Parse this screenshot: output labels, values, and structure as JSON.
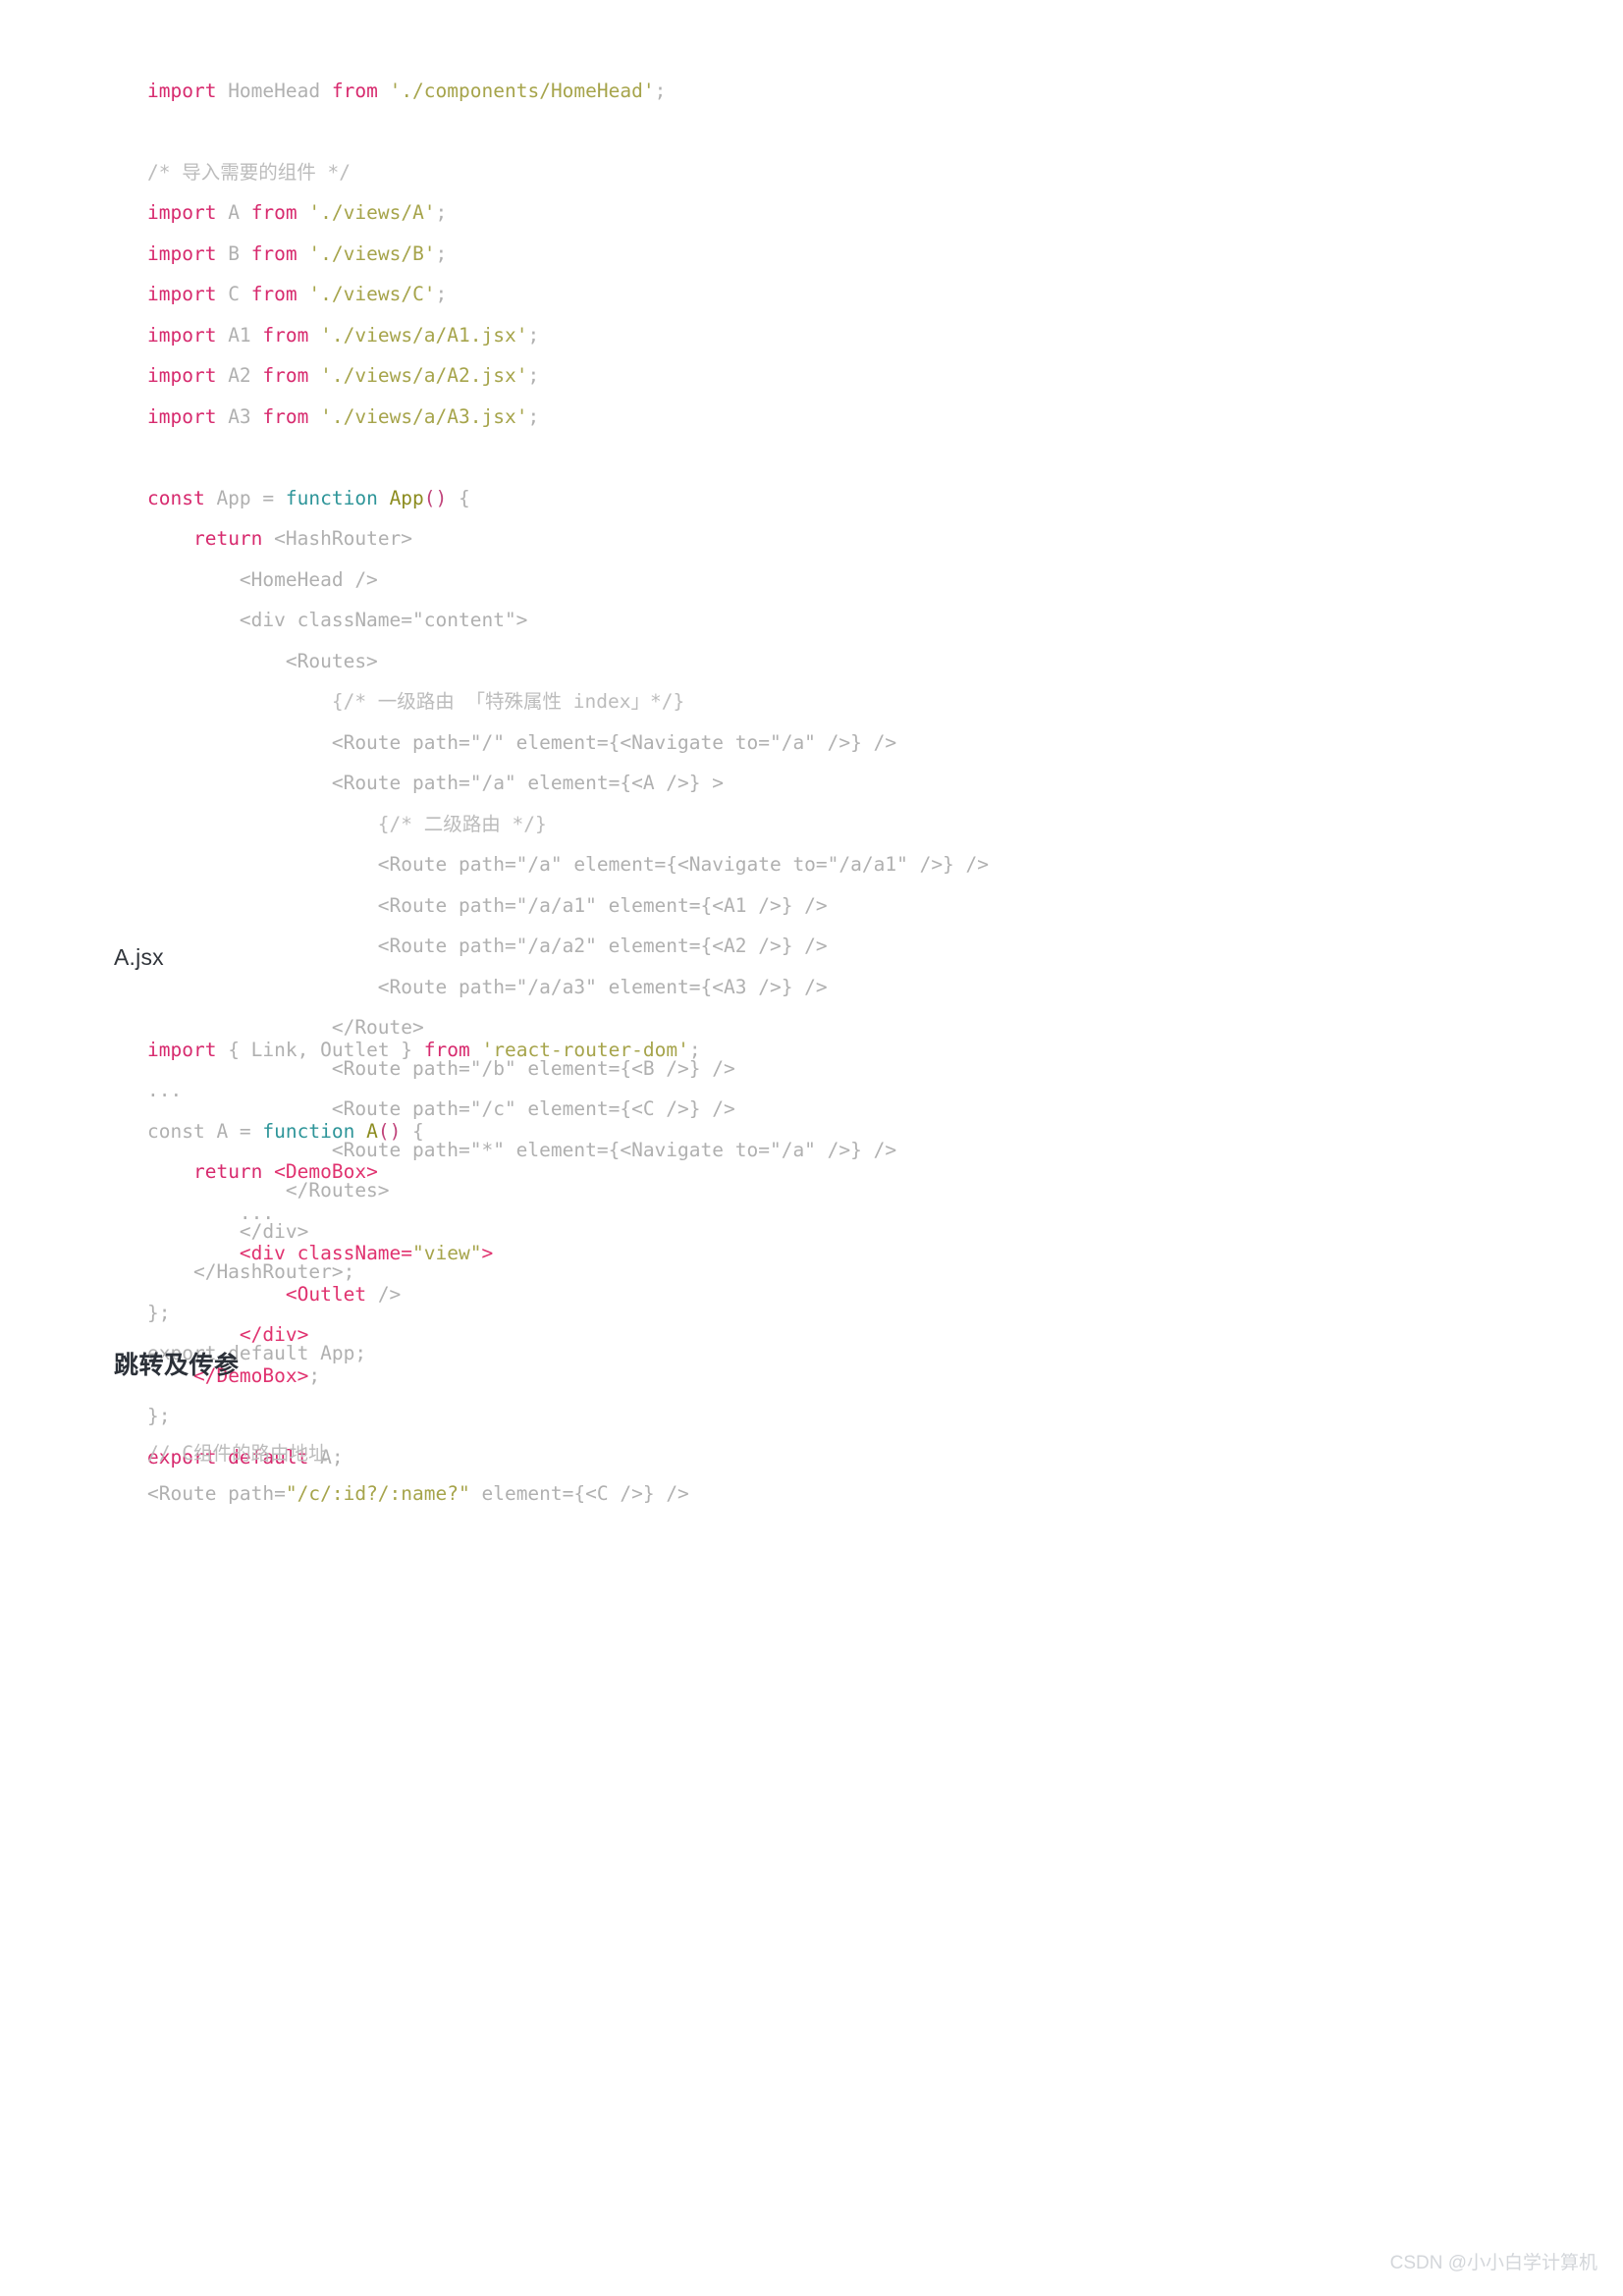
{
  "document": {
    "type": "blog-article-code-listing",
    "watermark": "CSDN @小小白学计算机",
    "background_color": "#ffffff",
    "colors": {
      "keyword": "#d72a6e",
      "string": "#a6a44b",
      "function_keyword": "#2e9599",
      "function_name": "#8c8c1f",
      "plain": "#b3b3b3",
      "comment": "#bcbcbc",
      "heading": "#2b3038"
    }
  },
  "headings": {
    "file_heading": "A.jsx",
    "section_heading": "跳转及传参"
  },
  "code_blocks": [
    {
      "id": "app-jsx",
      "lines": [
        [
          {
            "t": "import",
            "c": "kw"
          },
          {
            "t": " HomeHead ",
            "c": "plain"
          },
          {
            "t": "from",
            "c": "kw"
          },
          {
            "t": " ",
            "c": "plain"
          },
          {
            "t": "'./components/HomeHead'",
            "c": "str"
          },
          {
            "t": ";",
            "c": "plain"
          }
        ],
        [],
        [
          {
            "t": "/* 导入需要的组件 */",
            "c": "cmt"
          }
        ],
        [
          {
            "t": "import",
            "c": "kw"
          },
          {
            "t": " A ",
            "c": "plain"
          },
          {
            "t": "from",
            "c": "kw"
          },
          {
            "t": " ",
            "c": "plain"
          },
          {
            "t": "'./views/A'",
            "c": "str"
          },
          {
            "t": ";",
            "c": "plain"
          }
        ],
        [
          {
            "t": "import",
            "c": "kw"
          },
          {
            "t": " B ",
            "c": "plain"
          },
          {
            "t": "from",
            "c": "kw"
          },
          {
            "t": " ",
            "c": "plain"
          },
          {
            "t": "'./views/B'",
            "c": "str"
          },
          {
            "t": ";",
            "c": "plain"
          }
        ],
        [
          {
            "t": "import",
            "c": "kw"
          },
          {
            "t": " C ",
            "c": "plain"
          },
          {
            "t": "from",
            "c": "kw"
          },
          {
            "t": " ",
            "c": "plain"
          },
          {
            "t": "'./views/C'",
            "c": "str"
          },
          {
            "t": ";",
            "c": "plain"
          }
        ],
        [
          {
            "t": "import",
            "c": "kw"
          },
          {
            "t": " A1 ",
            "c": "plain"
          },
          {
            "t": "from",
            "c": "kw"
          },
          {
            "t": " ",
            "c": "plain"
          },
          {
            "t": "'./views/a/A1.jsx'",
            "c": "str"
          },
          {
            "t": ";",
            "c": "plain"
          }
        ],
        [
          {
            "t": "import",
            "c": "kw"
          },
          {
            "t": " A2 ",
            "c": "plain"
          },
          {
            "t": "from",
            "c": "kw"
          },
          {
            "t": " ",
            "c": "plain"
          },
          {
            "t": "'./views/a/A2.jsx'",
            "c": "str"
          },
          {
            "t": ";",
            "c": "plain"
          }
        ],
        [
          {
            "t": "import",
            "c": "kw"
          },
          {
            "t": " A3 ",
            "c": "plain"
          },
          {
            "t": "from",
            "c": "kw"
          },
          {
            "t": " ",
            "c": "plain"
          },
          {
            "t": "'./views/a/A3.jsx'",
            "c": "str"
          },
          {
            "t": ";",
            "c": "plain"
          }
        ],
        [],
        [
          {
            "t": "const",
            "c": "kw2"
          },
          {
            "t": " App = ",
            "c": "plain"
          },
          {
            "t": "function",
            "c": "fn"
          },
          {
            "t": " ",
            "c": "plain"
          },
          {
            "t": "App",
            "c": "fname"
          },
          {
            "t": "()",
            "c": "punc"
          },
          {
            "t": " {",
            "c": "plain"
          }
        ],
        [
          {
            "t": "    ",
            "c": "plain"
          },
          {
            "t": "return",
            "c": "kw"
          },
          {
            "t": " <HashRouter>",
            "c": "plain"
          }
        ],
        [
          {
            "t": "        <HomeHead />",
            "c": "plain"
          }
        ],
        [
          {
            "t": "        <div className=\"content\">",
            "c": "plain"
          }
        ],
        [
          {
            "t": "            <Routes>",
            "c": "plain"
          }
        ],
        [
          {
            "t": "                {/* 一级路由 「特殊属性 index」*/}",
            "c": "cmt"
          }
        ],
        [
          {
            "t": "                <Route path=\"/\" element={<Navigate to=\"/a\" />} />",
            "c": "plain"
          }
        ],
        [
          {
            "t": "                <Route path=\"/a\" element={<A />} >",
            "c": "plain"
          }
        ],
        [
          {
            "t": "                    {/* 二级路由 */}",
            "c": "cmt"
          }
        ],
        [
          {
            "t": "                    <Route path=\"/a\" element={<Navigate to=\"/a/a1\" />} />",
            "c": "plain"
          }
        ],
        [
          {
            "t": "                    <Route path=\"/a/a1\" element={<A1 />} />",
            "c": "plain"
          }
        ],
        [
          {
            "t": "                    <Route path=\"/a/a2\" element={<A2 />} />",
            "c": "plain"
          }
        ],
        [
          {
            "t": "                    <Route path=\"/a/a3\" element={<A3 />} />",
            "c": "plain"
          }
        ],
        [
          {
            "t": "                </Route>",
            "c": "plain"
          }
        ],
        [
          {
            "t": "                <Route path=\"/b\" element={<B />} />",
            "c": "plain"
          }
        ],
        [
          {
            "t": "                <Route path=\"/c\" element={<C />} />",
            "c": "plain"
          }
        ],
        [
          {
            "t": "                <Route path=\"*\" element={<Navigate to=\"/a\" />} />",
            "c": "plain"
          }
        ],
        [
          {
            "t": "            </Routes>",
            "c": "plain"
          }
        ],
        [
          {
            "t": "        </div>",
            "c": "plain"
          }
        ],
        [
          {
            "t": "    </HashRouter>;",
            "c": "plain"
          }
        ],
        [
          {
            "t": "};",
            "c": "plain"
          }
        ],
        [
          {
            "t": "export default App;",
            "c": "plain"
          }
        ]
      ]
    },
    {
      "id": "a-jsx",
      "lines": [
        [
          {
            "t": "import",
            "c": "kw"
          },
          {
            "t": " { Link, Outlet } ",
            "c": "plain"
          },
          {
            "t": "from",
            "c": "kw"
          },
          {
            "t": " ",
            "c": "plain"
          },
          {
            "t": "'react-router-dom'",
            "c": "str"
          },
          {
            "t": ";",
            "c": "plain"
          }
        ],
        [
          {
            "t": "...",
            "c": "plain"
          }
        ],
        [
          {
            "t": "const",
            "c": "plain"
          },
          {
            "t": " A = ",
            "c": "plain"
          },
          {
            "t": "function",
            "c": "fn"
          },
          {
            "t": " ",
            "c": "plain"
          },
          {
            "t": "A",
            "c": "fname"
          },
          {
            "t": "()",
            "c": "punc"
          },
          {
            "t": " {",
            "c": "plain"
          }
        ],
        [
          {
            "t": "    ",
            "c": "plain"
          },
          {
            "t": "return",
            "c": "kw"
          },
          {
            "t": " ",
            "c": "plain"
          },
          {
            "t": "<DemoBox>",
            "c": "tag"
          }
        ],
        [
          {
            "t": "        ...",
            "c": "plain"
          }
        ],
        [
          {
            "t": "        ",
            "c": "plain"
          },
          {
            "t": "<div ",
            "c": "tag"
          },
          {
            "t": "className=",
            "c": "attr"
          },
          {
            "t": "\"view\"",
            "c": "str"
          },
          {
            "t": ">",
            "c": "tag"
          }
        ],
        [
          {
            "t": "            ",
            "c": "plain"
          },
          {
            "t": "<Outlet",
            "c": "tag"
          },
          {
            "t": " />",
            "c": "plain"
          }
        ],
        [
          {
            "t": "        ",
            "c": "plain"
          },
          {
            "t": "</div>",
            "c": "tag"
          }
        ],
        [
          {
            "t": "    ",
            "c": "plain"
          },
          {
            "t": "</DemoBox>",
            "c": "tag"
          },
          {
            "t": ";",
            "c": "plain"
          }
        ],
        [
          {
            "t": "};",
            "c": "plain"
          }
        ],
        [
          {
            "t": "export default",
            "c": "kw"
          },
          {
            "t": " A;",
            "c": "plain"
          }
        ]
      ]
    },
    {
      "id": "route-params",
      "lines": [
        [
          {
            "t": "// C组件的路由地址",
            "c": "cmt"
          }
        ],
        [
          {
            "t": "<Route path=",
            "c": "plain"
          },
          {
            "t": "\"/c/:id?/:name?\"",
            "c": "str"
          },
          {
            "t": " element={<C />} />",
            "c": "plain"
          }
        ]
      ]
    }
  ]
}
